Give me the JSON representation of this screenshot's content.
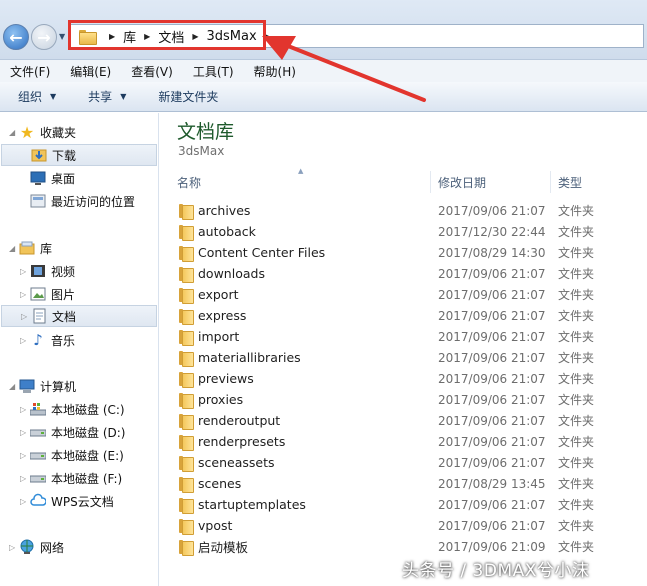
{
  "address": {
    "breadcrumbs": [
      "库",
      "文档",
      "3dsMax"
    ],
    "highlight_color": "#e2352e"
  },
  "menu": [
    "文件(F)",
    "编辑(E)",
    "查看(V)",
    "工具(T)",
    "帮助(H)"
  ],
  "commands": {
    "organize": "组织",
    "share": "共享",
    "new_folder": "新建文件夹"
  },
  "nav": {
    "favorites": {
      "label": "收藏夹",
      "items": [
        "下载",
        "桌面",
        "最近访问的位置"
      ]
    },
    "libraries": {
      "label": "库",
      "items": [
        "视频",
        "图片",
        "文档",
        "音乐"
      ]
    },
    "computer": {
      "label": "计算机",
      "items": [
        "本地磁盘 (C:)",
        "本地磁盘 (D:)",
        "本地磁盘 (E:)",
        "本地磁盘 (F:)",
        "WPS云文档"
      ]
    },
    "network": {
      "label": "网络"
    }
  },
  "content": {
    "title": "文档库",
    "subtitle": "3dsMax",
    "columns": {
      "name": "名称",
      "date": "修改日期",
      "type": "类型"
    },
    "files": [
      {
        "name": "archives",
        "date": "2017/09/06 21:07",
        "type": "文件夹"
      },
      {
        "name": "autoback",
        "date": "2017/12/30 22:44",
        "type": "文件夹"
      },
      {
        "name": "Content Center Files",
        "date": "2017/08/29 14:30",
        "type": "文件夹"
      },
      {
        "name": "downloads",
        "date": "2017/09/06 21:07",
        "type": "文件夹"
      },
      {
        "name": "export",
        "date": "2017/09/06 21:07",
        "type": "文件夹"
      },
      {
        "name": "express",
        "date": "2017/09/06 21:07",
        "type": "文件夹"
      },
      {
        "name": "import",
        "date": "2017/09/06 21:07",
        "type": "文件夹"
      },
      {
        "name": "materiallibraries",
        "date": "2017/09/06 21:07",
        "type": "文件夹"
      },
      {
        "name": "previews",
        "date": "2017/09/06 21:07",
        "type": "文件夹"
      },
      {
        "name": "proxies",
        "date": "2017/09/06 21:07",
        "type": "文件夹"
      },
      {
        "name": "renderoutput",
        "date": "2017/09/06 21:07",
        "type": "文件夹"
      },
      {
        "name": "renderpresets",
        "date": "2017/09/06 21:07",
        "type": "文件夹"
      },
      {
        "name": "sceneassets",
        "date": "2017/09/06 21:07",
        "type": "文件夹"
      },
      {
        "name": "scenes",
        "date": "2017/08/29 13:45",
        "type": "文件夹"
      },
      {
        "name": "startuptemplates",
        "date": "2017/09/06 21:07",
        "type": "文件夹"
      },
      {
        "name": "vpost",
        "date": "2017/09/06 21:07",
        "type": "文件夹"
      },
      {
        "name": "启动模板",
        "date": "2017/09/06 21:09",
        "type": "文件夹"
      }
    ]
  },
  "watermark": "头条号 / 3DMAX兮小沫"
}
